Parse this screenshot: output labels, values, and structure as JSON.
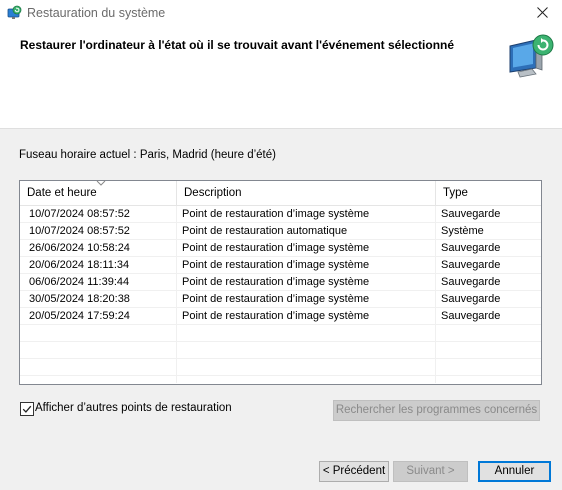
{
  "window": {
    "title": "Restauration du système"
  },
  "header": {
    "heading": "Restaurer l'ordinateur à l'état où il se trouvait avant l'événement sélectionné"
  },
  "timezone_text": "Fuseau horaire actuel : Paris, Madrid (heure d’été)",
  "table": {
    "columns": [
      "Date et heure",
      "Description",
      "Type"
    ],
    "rows": [
      [
        "10/07/2024 08:57:52",
        "Point de restauration d’image système",
        "Sauvegarde"
      ],
      [
        "10/07/2024 08:57:52",
        "Point de restauration automatique",
        "Système"
      ],
      [
        "26/06/2024 10:58:24",
        "Point de restauration d’image système",
        "Sauvegarde"
      ],
      [
        "20/06/2024 18:11:34",
        "Point de restauration d’image système",
        "Sauvegarde"
      ],
      [
        "06/06/2024 11:39:44",
        "Point de restauration d’image système",
        "Sauvegarde"
      ],
      [
        "30/05/2024 18:20:38",
        "Point de restauration d’image système",
        "Sauvegarde"
      ],
      [
        "20/05/2024 17:59:24",
        "Point de restauration d’image système",
        "Sauvegarde"
      ]
    ],
    "sorted_column": "Date et heure"
  },
  "show_more_checkbox": {
    "label": "Afficher d’autres points de restauration",
    "checked": true
  },
  "scan_button": {
    "label": "Rechercher les programmes concernés",
    "disabled": true
  },
  "nav": {
    "back_label": "< Précédent",
    "next_label": "Suivant >",
    "next_disabled": true,
    "cancel_label": "Annuler"
  },
  "icons": {
    "app": "system-restore-icon",
    "hero": "computer-restore-icon",
    "close": "close-icon",
    "sort": "sort-descending-icon",
    "check": "checkmark-icon"
  },
  "colors": {
    "accent": "#0078d7",
    "content_bg": "#f0f0f0",
    "disabled_text": "#8a8a8a"
  }
}
